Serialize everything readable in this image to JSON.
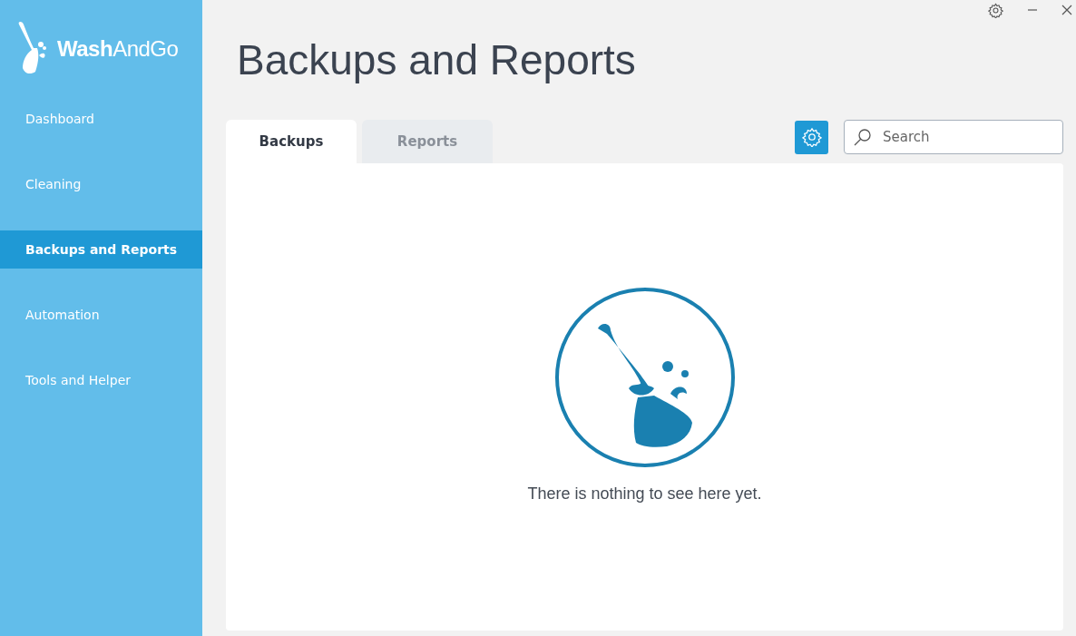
{
  "app": {
    "logo": "**Wash**AndGo"
  },
  "sidebar": {
    "items": [
      {
        "label": "Dashboard",
        "selected": false
      },
      {
        "label": "Cleaning",
        "selected": false
      },
      {
        "label": "Backups and Reports",
        "selected": true
      },
      {
        "label": "Automation",
        "selected": false
      },
      {
        "label": "Tools and Helper",
        "selected": false
      }
    ]
  },
  "page": {
    "title": "Backups and Reports"
  },
  "tabs": [
    {
      "label": "Backups",
      "selected": true
    },
    {
      "label": "Reports",
      "selected": false
    }
  ],
  "search": {
    "placeholder": "Search"
  },
  "empty_state": {
    "message": "There is nothing to see here yet."
  }
}
